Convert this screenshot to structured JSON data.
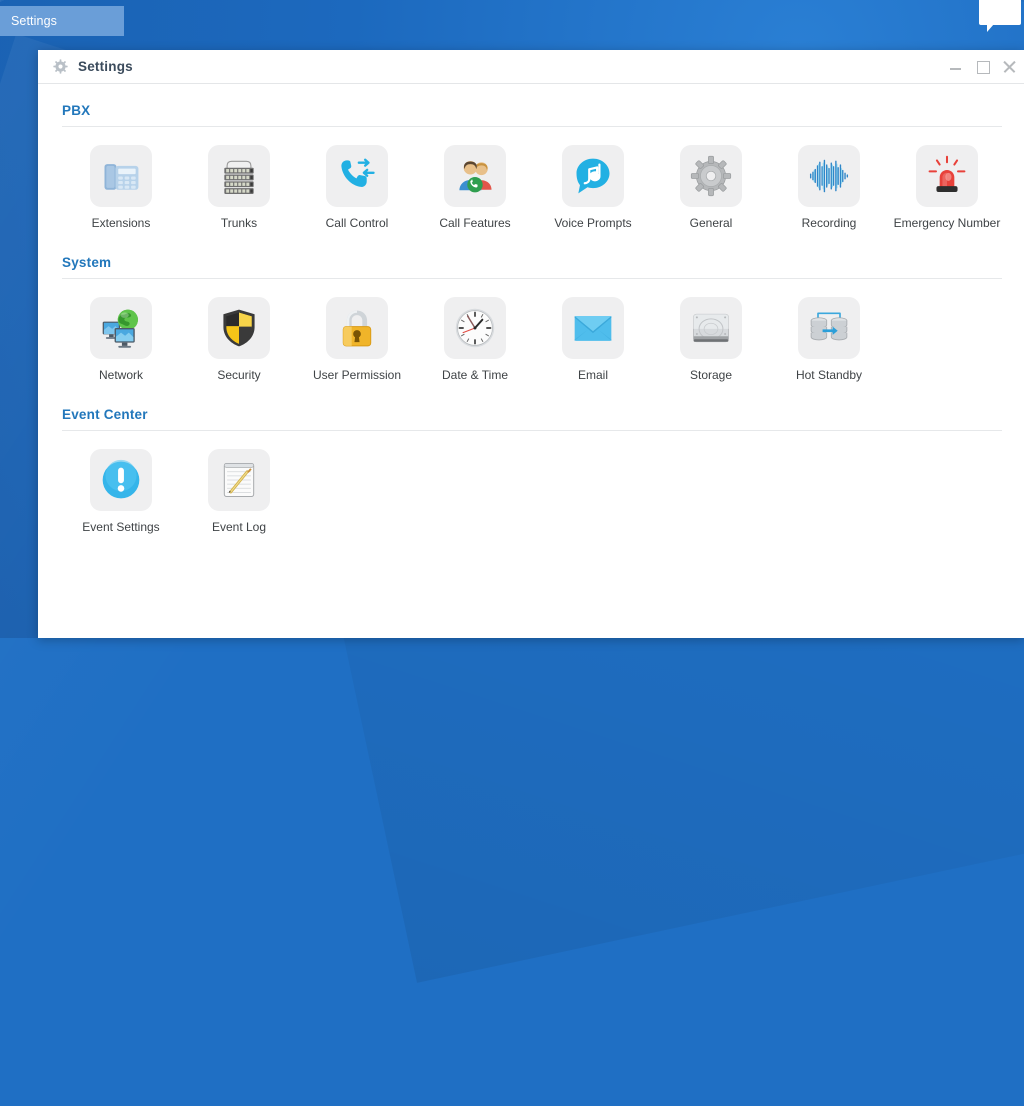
{
  "taskbar": {
    "tab_label": "Settings",
    "chat_icon": "speech-bubble-icon"
  },
  "window": {
    "title": "Settings",
    "title_icon": "gear-icon",
    "controls": {
      "minimize": "minimize-icon",
      "maximize": "maximize-icon",
      "close": "close-icon"
    }
  },
  "colors": {
    "desktop_blue": "#1f6fc4",
    "taskbar_tab": "#6a9ed8",
    "section_heading": "#2277bb",
    "tile_background": "#efeff0",
    "label_text": "#3f4346",
    "divider": "#e6e8ea"
  },
  "sections": [
    {
      "id": "pbx",
      "title": "PBX",
      "items": [
        {
          "label": "Extensions",
          "icon": "desk-phone-icon"
        },
        {
          "label": "Trunks",
          "icon": "patch-panel-icon"
        },
        {
          "label": "Call Control",
          "icon": "call-transfer-icon"
        },
        {
          "label": "Call Features",
          "icon": "users-call-icon"
        },
        {
          "label": "Voice Prompts",
          "icon": "music-note-bubble-icon"
        },
        {
          "label": "General",
          "icon": "gear-icon"
        },
        {
          "label": "Recording",
          "icon": "waveform-icon"
        },
        {
          "label": "Emergency Number",
          "icon": "siren-light-icon"
        }
      ]
    },
    {
      "id": "system",
      "title": "System",
      "items": [
        {
          "label": "Network",
          "icon": "monitors-globe-icon"
        },
        {
          "label": "Security",
          "icon": "shield-icon"
        },
        {
          "label": "User Permission",
          "icon": "padlock-icon"
        },
        {
          "label": "Date & Time",
          "icon": "clock-icon"
        },
        {
          "label": "Email",
          "icon": "envelope-icon"
        },
        {
          "label": "Storage",
          "icon": "hard-disk-icon"
        },
        {
          "label": "Hot Standby",
          "icon": "database-sync-icon"
        }
      ]
    },
    {
      "id": "event-center",
      "title": "Event Center",
      "items": [
        {
          "label": "Event Settings",
          "icon": "exclamation-circle-icon"
        },
        {
          "label": "Event Log",
          "icon": "notepad-pencil-icon"
        }
      ]
    }
  ]
}
